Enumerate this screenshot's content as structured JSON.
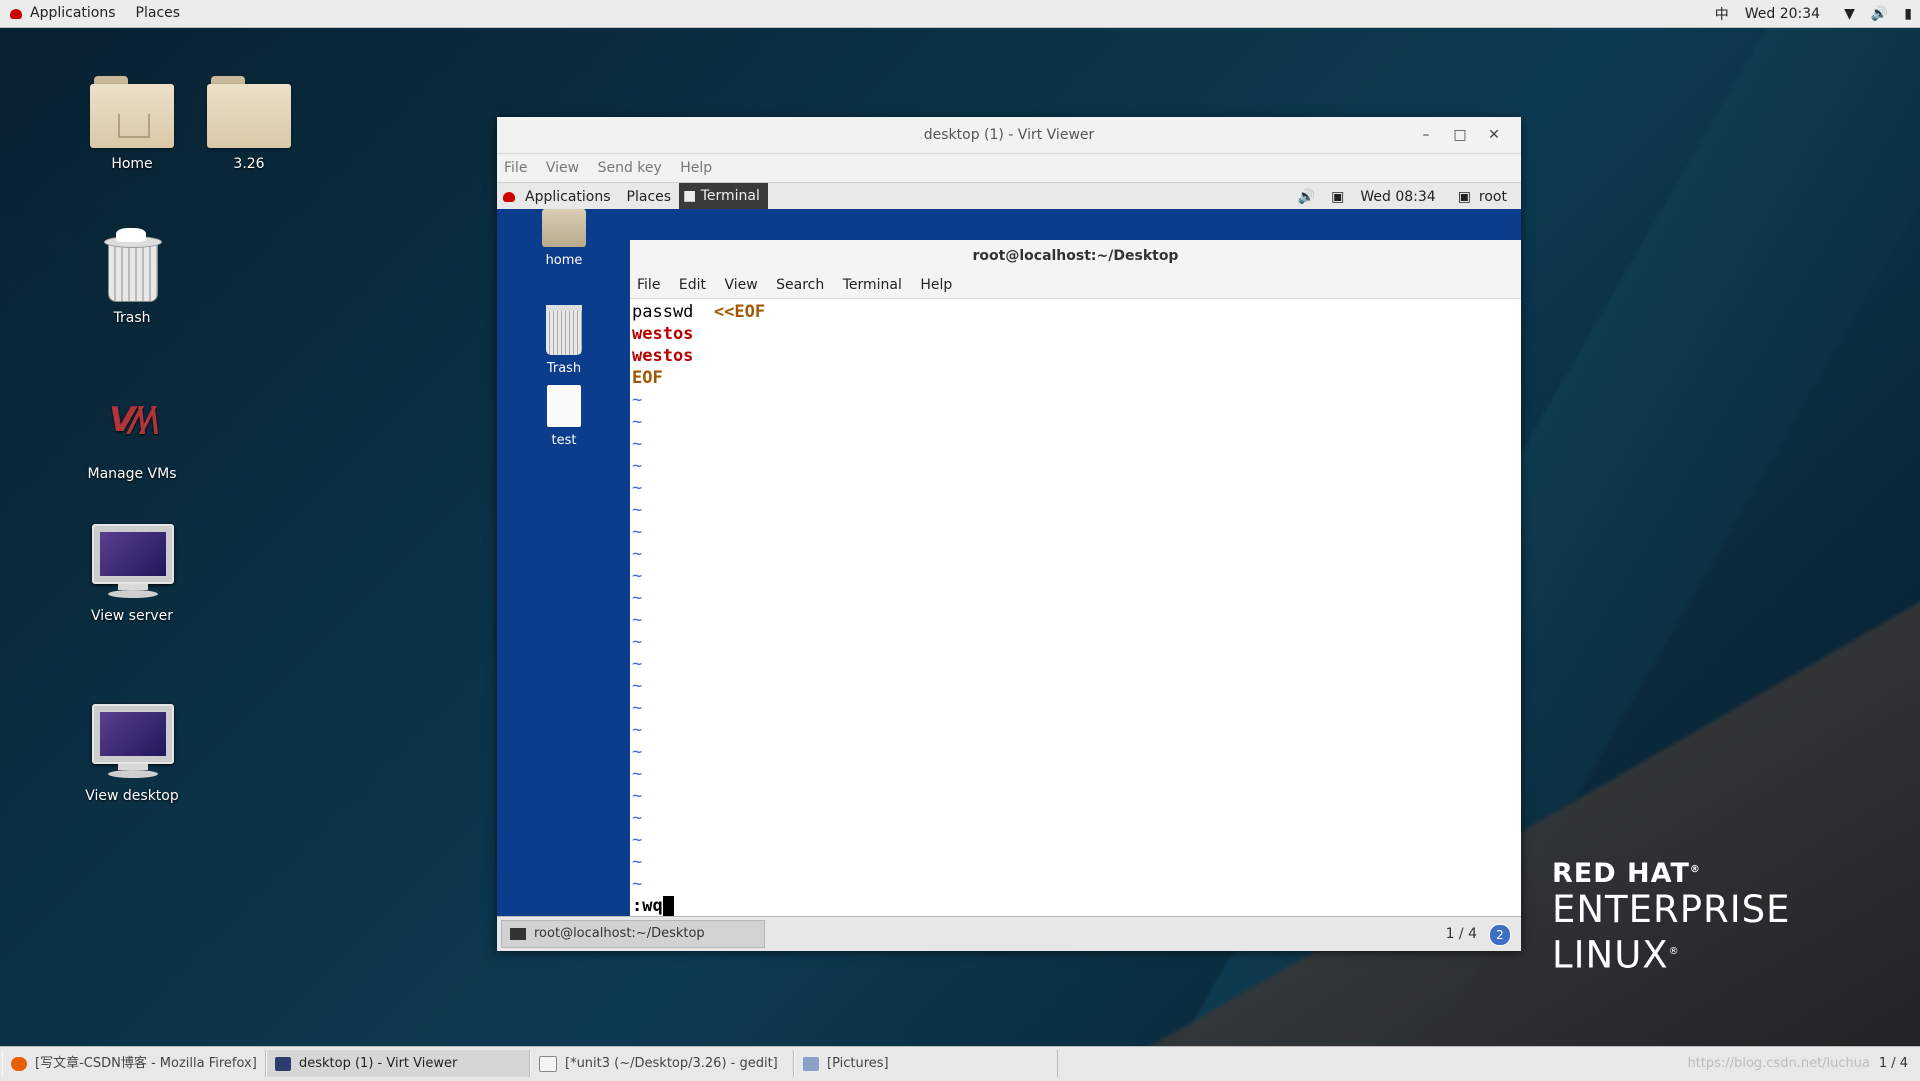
{
  "topbar": {
    "applications": "Applications",
    "places": "Places",
    "ime": "中",
    "clock": "Wed 20:34"
  },
  "desktop": {
    "icons": [
      {
        "label": "Home"
      },
      {
        "label": "3.26"
      },
      {
        "label": "Trash"
      },
      {
        "label": "Manage VMs"
      },
      {
        "label": "View server"
      },
      {
        "label": "View desktop"
      }
    ]
  },
  "viewer": {
    "title": "desktop (1) - Virt Viewer",
    "menu": [
      "File",
      "View",
      "Send key",
      "Help"
    ],
    "guest_top": {
      "applications": "Applications",
      "places": "Places",
      "terminal": "Terminal",
      "clock": "Wed 08:34",
      "user": "root"
    },
    "guest_icons": [
      {
        "label": "home"
      },
      {
        "label": "Trash"
      },
      {
        "label": "test"
      }
    ],
    "terminal": {
      "title": "root@localhost:~/Desktop",
      "menu": [
        "File",
        "Edit",
        "View",
        "Search",
        "Terminal",
        "Help"
      ],
      "line1_cmd": "passwd  ",
      "line1_heredoc": "<<EOF",
      "line2": "westos",
      "line3": "westos",
      "line4": "EOF",
      "tilde": "~",
      "command": ":wq"
    },
    "guest_task": "root@localhost:~/Desktop",
    "guest_page": "1 / 4",
    "guest_badge": "2"
  },
  "logo": {
    "line1": "RED HAT",
    "mark": "®",
    "line2": "ENTERPRISE",
    "line3": "LINUX",
    "mark2": "®"
  },
  "taskbar": {
    "tasks": [
      "[写文章-CSDN博客 - Mozilla Firefox]",
      "desktop (1) - Virt Viewer",
      "[*unit3 (~/Desktop/3.26) - gedit]",
      "[Pictures]"
    ],
    "watermark": "https://blog.csdn.net/luchua",
    "page": "1 / 4"
  }
}
